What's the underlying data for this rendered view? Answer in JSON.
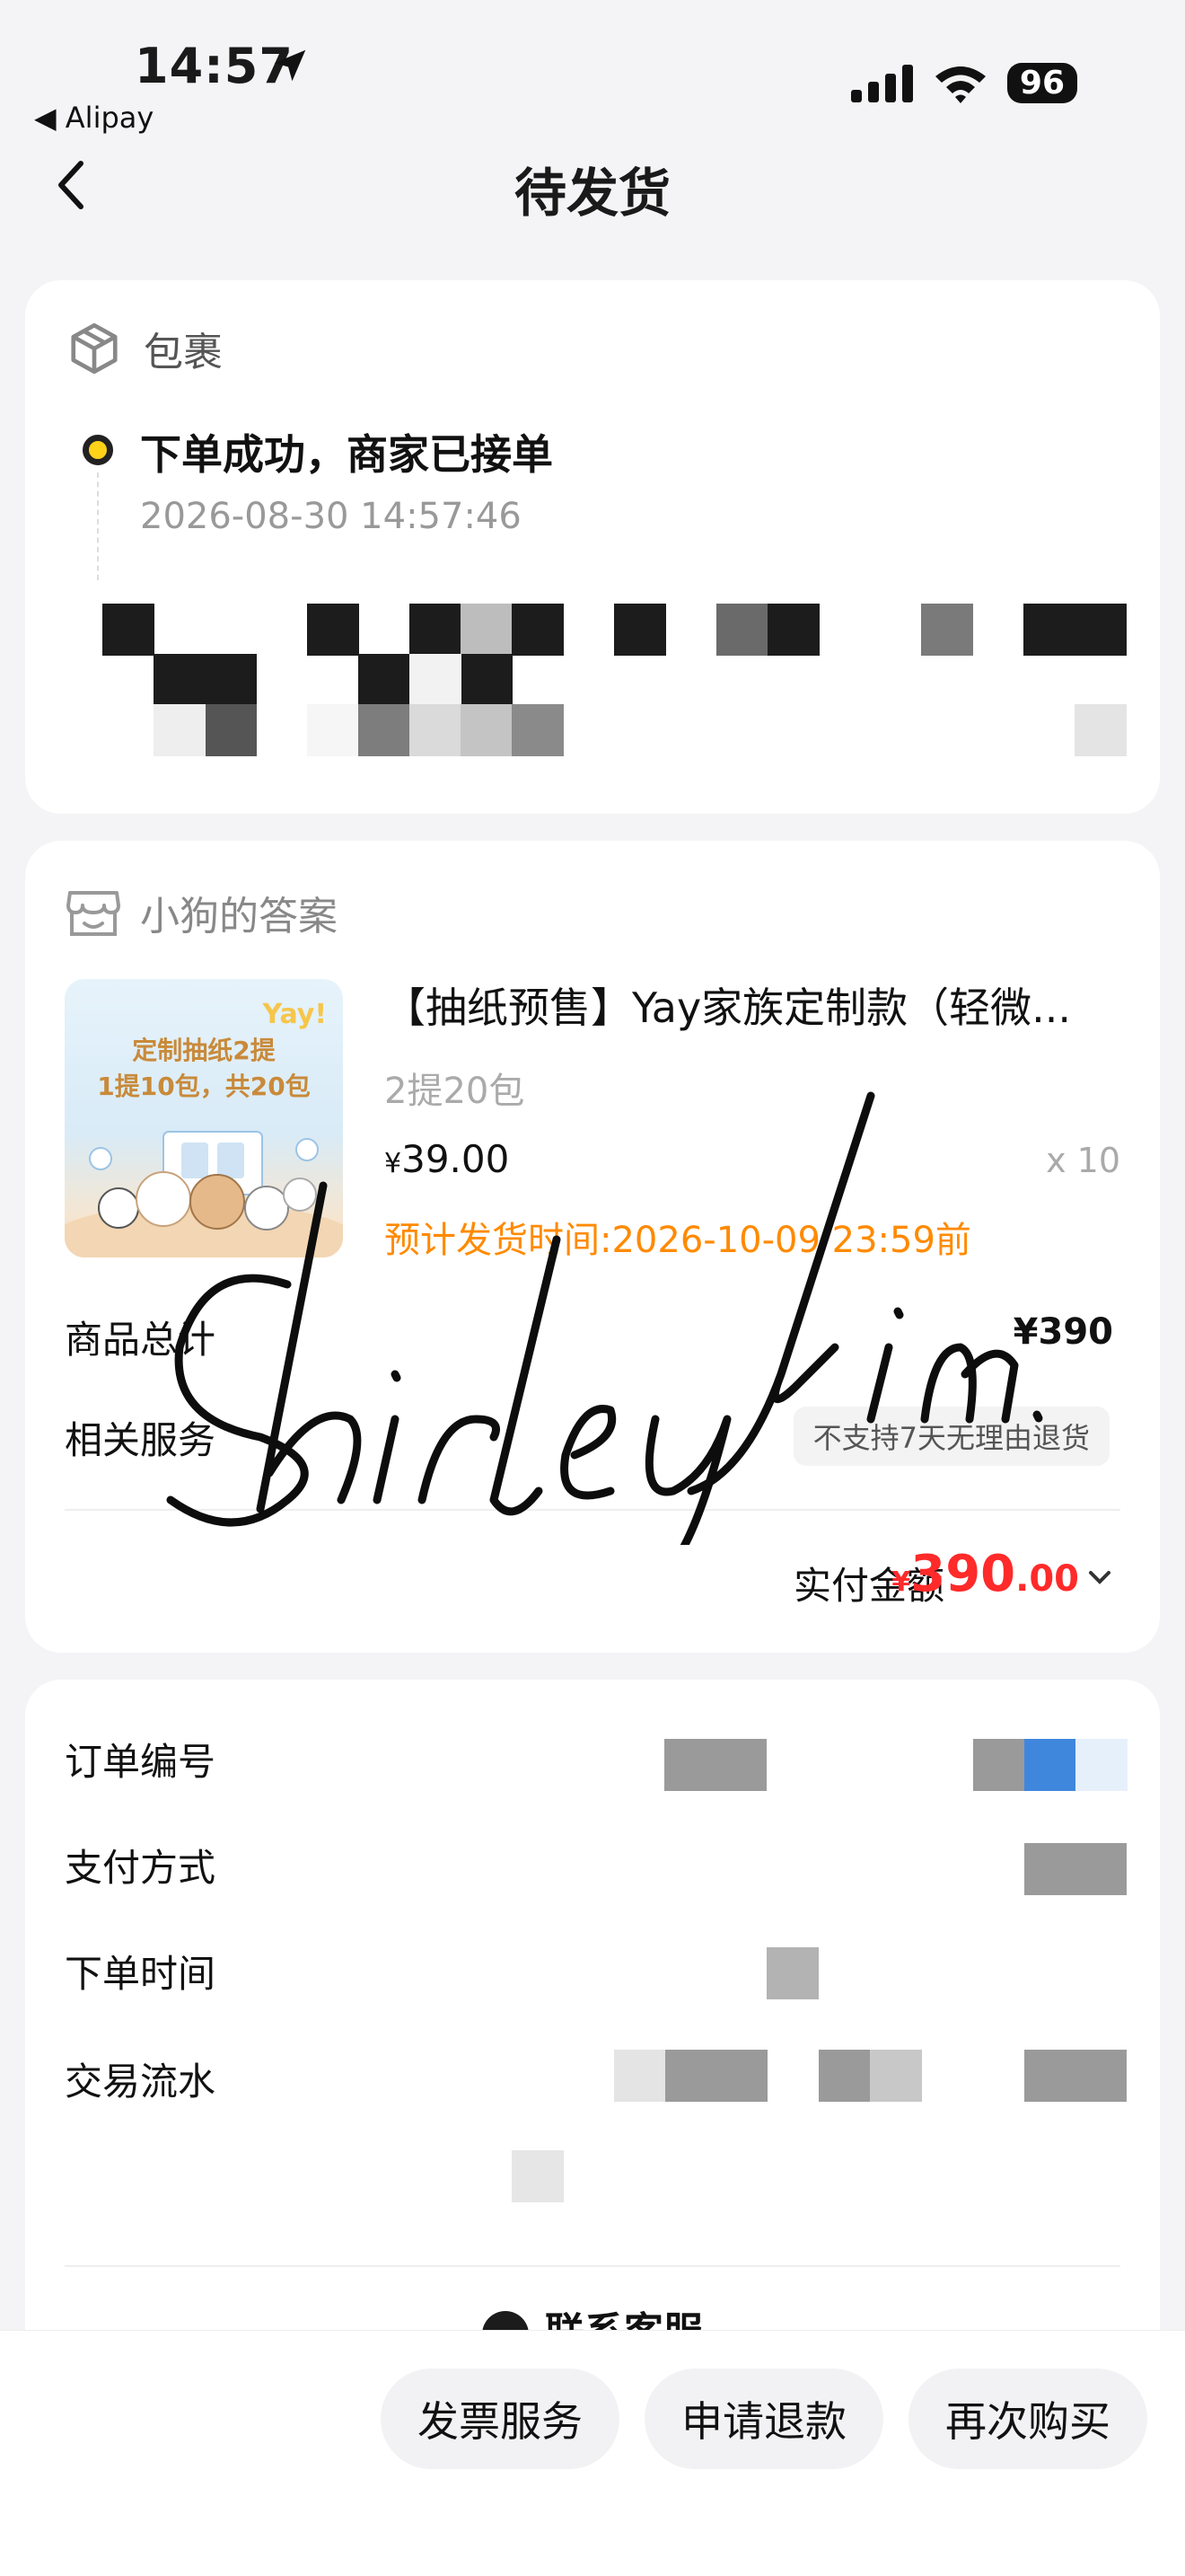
{
  "status_bar": {
    "time": "14:57",
    "back_app": "◀ Alipay",
    "battery": "96"
  },
  "nav": {
    "title": "待发货"
  },
  "package": {
    "header": "包裹",
    "timeline_title": "下单成功，商家已接单",
    "timeline_time": "2026-08-30 14:57:46"
  },
  "shop": {
    "name": "小狗的答案",
    "thumbnail": {
      "brand": "Yay!",
      "line1": "定制抽纸2提",
      "line2": "1提10包，共20包"
    },
    "product": {
      "title": "【抽纸预售】Yay家族定制款（轻微...",
      "spec": "2提20包",
      "price_symbol": "¥",
      "price": "39.00",
      "quantity": "x 10",
      "ship_time": "预计发货时间:2026-10-09 23:59前"
    },
    "total_label": "商品总计",
    "total_value": "¥390",
    "service_label": "相关服务",
    "service_tag": "不支持7天无理由退货",
    "paid_label": "实付金额",
    "paid_currency": "¥",
    "paid_integer": "390",
    "paid_decimal": ".00"
  },
  "order_info": {
    "order_no_label": "订单编号",
    "pay_method_label": "支付方式",
    "order_time_label": "下单时间",
    "transaction_label": "交易流水",
    "contact_label": "联系客服"
  },
  "actions": {
    "invoice": "发票服务",
    "refund": "申请退款",
    "rebuy": "再次购买"
  },
  "watermark_signature": "Shirley Y in."
}
